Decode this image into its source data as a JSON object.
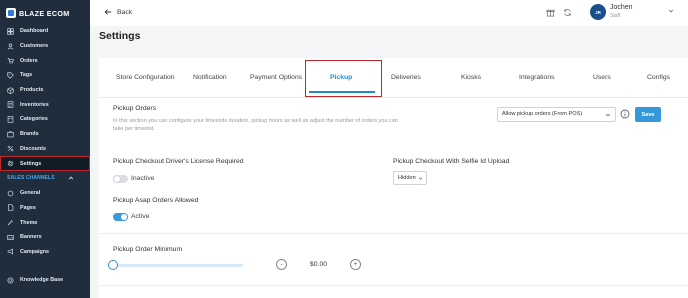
{
  "brand": {
    "name": "BLAZE ECOM"
  },
  "sidebar": {
    "items": [
      {
        "label": "Dashboard",
        "icon": "dashboard-icon"
      },
      {
        "label": "Customers",
        "icon": "customers-icon"
      },
      {
        "label": "Orders",
        "icon": "orders-icon"
      },
      {
        "label": "Tags",
        "icon": "tag-icon"
      },
      {
        "label": "Products",
        "icon": "products-icon"
      },
      {
        "label": "Inventories",
        "icon": "inventory-icon"
      },
      {
        "label": "Categories",
        "icon": "categories-icon"
      },
      {
        "label": "Brands",
        "icon": "brands-icon"
      },
      {
        "label": "Discounts",
        "icon": "discount-icon"
      },
      {
        "label": "Settings",
        "icon": "gear-icon",
        "active": true
      }
    ],
    "section_label": "SALES CHANNELS",
    "channel_items": [
      {
        "label": "General",
        "icon": "general-icon"
      },
      {
        "label": "Pages",
        "icon": "pages-icon"
      },
      {
        "label": "Theme",
        "icon": "theme-icon"
      },
      {
        "label": "Banners",
        "icon": "banners-icon"
      },
      {
        "label": "Campaigns",
        "icon": "campaigns-icon"
      }
    ],
    "knowledge_base": "Knowledge Base"
  },
  "header": {
    "back_label": "Back",
    "user": {
      "initials": "JR",
      "name": "Jochen",
      "role": "Staff"
    }
  },
  "page": {
    "title": "Settings"
  },
  "tabs": [
    {
      "label": "Store Configuration"
    },
    {
      "label": "Notification"
    },
    {
      "label": "Payment Options"
    },
    {
      "label": "Pickup",
      "active": true
    },
    {
      "label": "Deliveries"
    },
    {
      "label": "Kiosks"
    },
    {
      "label": "Integrations"
    },
    {
      "label": "Users"
    },
    {
      "label": "Configs"
    }
  ],
  "pickup": {
    "orders_title": "Pickup Orders",
    "orders_description": "In this section you can configure your timeslots duration, pickup hours as well as adjust the number of orders you can take per timeslot.",
    "orders_select_value": "Allow pickup orders (From POS)",
    "save_label": "Save",
    "license_title": "Pickup Checkout Driver's License Required",
    "license_status": "Inactive",
    "license_enabled": false,
    "selfie_title": "Pickup Checkout With Selfie Id Upload",
    "selfie_value": "Hidden",
    "asap_title": "Pickup Asap Orders Allowed",
    "asap_status": "Active",
    "asap_enabled": true,
    "minimum_title": "Pickup Order Minimum",
    "minimum_amount": "$0.00",
    "minimum_slider_fraction": 0,
    "minus_symbol": "-",
    "plus_symbol": "+"
  },
  "colors": {
    "accent": "#1f8ad6",
    "sidebar_bg": "#1f2d3d",
    "highlight": "#c1272d"
  }
}
